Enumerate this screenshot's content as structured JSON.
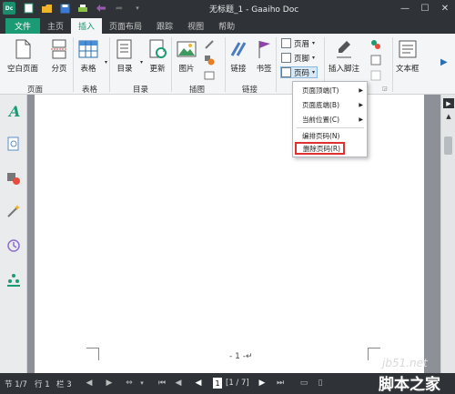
{
  "app": {
    "logo_text": "Dc",
    "window_title": "无标题_1 - Gaaiho Doc"
  },
  "menu_tabs": [
    {
      "label": "文件"
    },
    {
      "label": "主页"
    },
    {
      "label": "插入"
    },
    {
      "label": "页面布局"
    },
    {
      "label": "跟踪"
    },
    {
      "label": "视图"
    },
    {
      "label": "帮助"
    }
  ],
  "ribbon": {
    "buttons": {
      "blank_page": "空白页面",
      "page_break": "分页",
      "table": "表格",
      "toc": "目录",
      "update": "更新",
      "picture": "图片",
      "link": "链接",
      "bookmark": "书签",
      "header": "页眉",
      "footer": "页脚",
      "page_number": "页码",
      "insert_footnote": "插入脚注",
      "text_box": "文本框"
    },
    "groups": {
      "page": "页面",
      "table": "表格",
      "toc": "目录",
      "illustration": "插图",
      "link": "链接"
    }
  },
  "dropdown": {
    "items": [
      {
        "label": "页面顶端(T)",
        "has_submenu": true
      },
      {
        "label": "页面底端(B)",
        "has_submenu": true
      },
      {
        "label": "当前位置(C)",
        "has_submenu": true
      },
      {
        "label": "编排页码(N)",
        "has_submenu": false
      },
      {
        "label": "删除页码(R)",
        "has_submenu": false,
        "highlighted": true
      }
    ]
  },
  "document": {
    "page_number_text": "- 1 -↵"
  },
  "statusbar": {
    "section": "节 1/7",
    "line": "行 1",
    "column": "栏 3",
    "current_page": "1",
    "page_count": "[1 / 7]"
  },
  "watermark": {
    "line1": "jb51.net",
    "line2": "脚本之家"
  },
  "colors": {
    "accent": "#1a9b74",
    "highlight_border": "#e03131",
    "titlebar": "#2f3338"
  }
}
